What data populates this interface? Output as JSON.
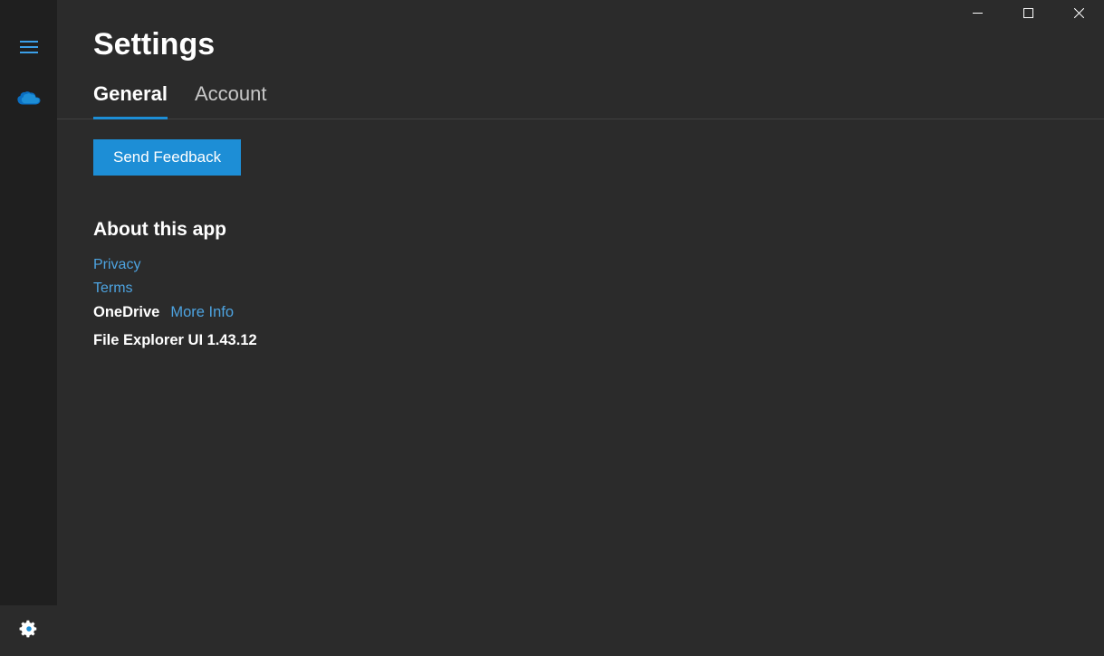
{
  "header": {
    "title": "Settings"
  },
  "tabs": [
    {
      "label": "General",
      "active": true
    },
    {
      "label": "Account",
      "active": false
    }
  ],
  "content": {
    "feedback_button": "Send Feedback",
    "about_heading": "About this app",
    "privacy_link": "Privacy",
    "terms_link": "Terms",
    "app_name": "OneDrive",
    "more_info_link": "More Info",
    "version_text": "File Explorer UI 1.43.12"
  },
  "sidebar": {
    "hamburger": "hamburger-icon",
    "cloud": "onedrive-icon",
    "settings": "gear-icon"
  },
  "colors": {
    "accent": "#1d8ed6",
    "link": "#4da3e0",
    "background": "#2b2b2b",
    "sidebar_bg": "#1f1f1f"
  }
}
